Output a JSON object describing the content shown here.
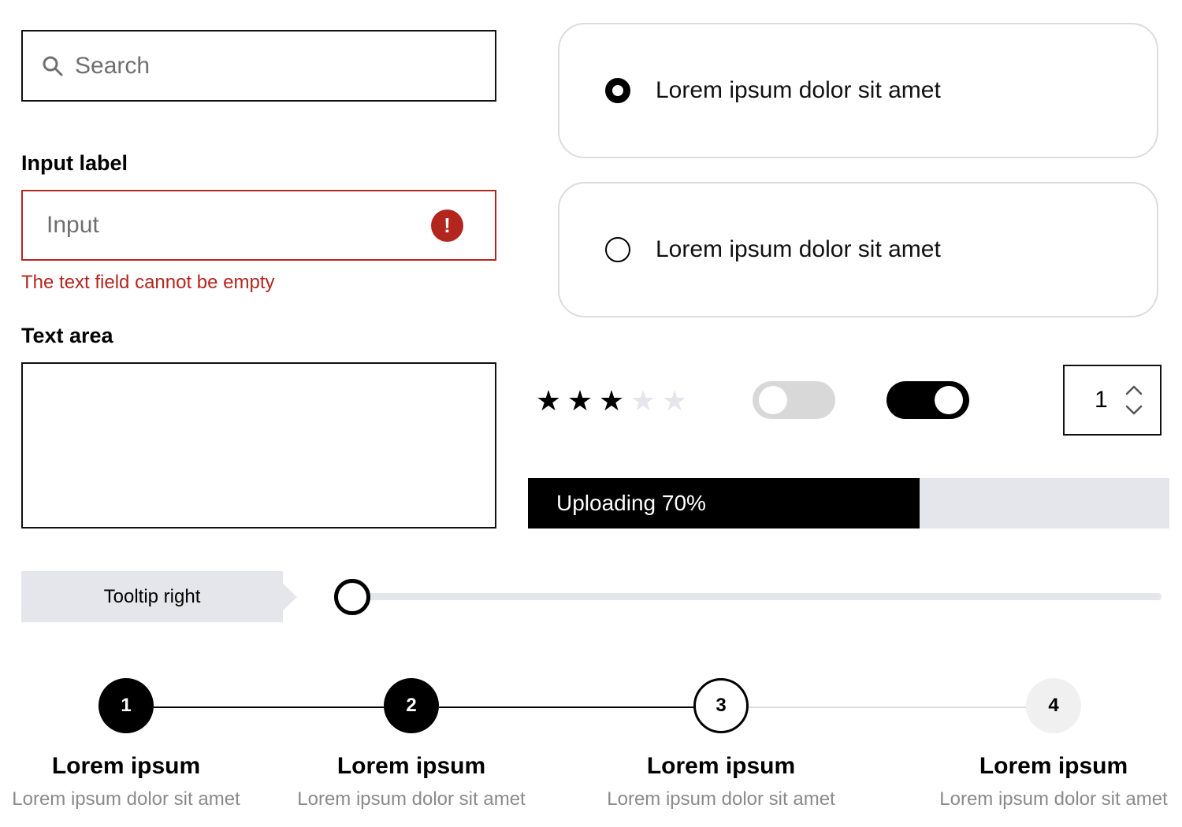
{
  "search": {
    "placeholder": "Search",
    "icon": "search-icon"
  },
  "input": {
    "label": "Input label",
    "placeholder": "Input",
    "error_message": "The text field cannot be empty",
    "error_icon": "exclamation-icon",
    "error_color": "#b3261e"
  },
  "textarea": {
    "label": "Text area",
    "value": ""
  },
  "radio_options": [
    {
      "label": "Lorem ipsum dolor sit amet",
      "checked": true
    },
    {
      "label": "Lorem ipsum dolor sit amet",
      "checked": false
    }
  ],
  "rating": {
    "value": 3,
    "max": 5,
    "filled_color": "#000000",
    "empty_color": "#e4e6eb"
  },
  "toggles": [
    {
      "on": false
    },
    {
      "on": true
    }
  ],
  "quantity": {
    "value": "1"
  },
  "progress": {
    "label": "Uploading 70%",
    "percent": 61
  },
  "tooltip": {
    "text": "Tooltip right"
  },
  "slider": {
    "value": 0
  },
  "steps": [
    {
      "number": "1",
      "title": "Lorem ipsum",
      "description": "Lorem ipsum dolor sit amet",
      "state": "complete"
    },
    {
      "number": "2",
      "title": "Lorem ipsum",
      "description": "Lorem ipsum dolor sit amet",
      "state": "complete"
    },
    {
      "number": "3",
      "title": "Lorem ipsum",
      "description": "Lorem ipsum dolor sit amet",
      "state": "active"
    },
    {
      "number": "4",
      "title": "Lorem ipsum",
      "description": "Lorem ipsum dolor sit amet",
      "state": "pending"
    }
  ]
}
